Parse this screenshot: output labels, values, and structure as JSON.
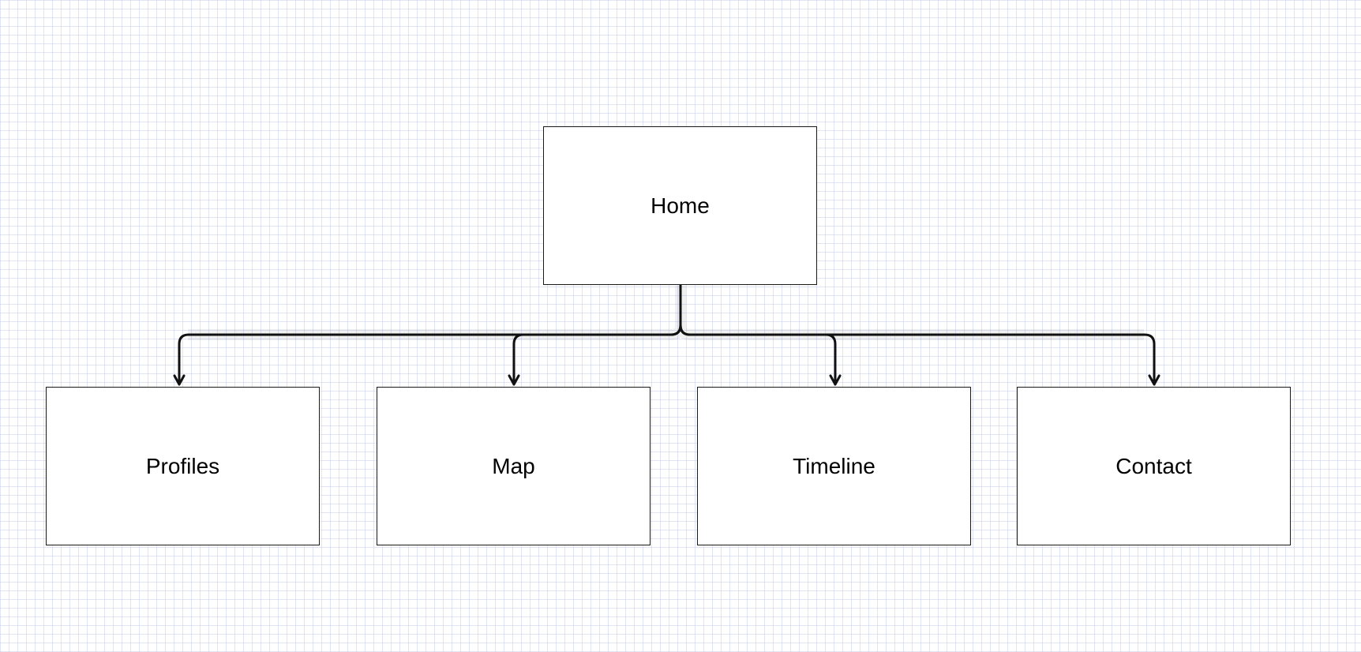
{
  "diagram": {
    "root": {
      "label": "Home"
    },
    "children": [
      {
        "label": "Profiles"
      },
      {
        "label": "Map"
      },
      {
        "label": "Timeline"
      },
      {
        "label": "Contact"
      }
    ]
  },
  "colors": {
    "background": "#ffffff",
    "grid": "#dfe2f2",
    "stroke": "#111111",
    "node_fill": "#ffffff",
    "text": "#000000"
  }
}
